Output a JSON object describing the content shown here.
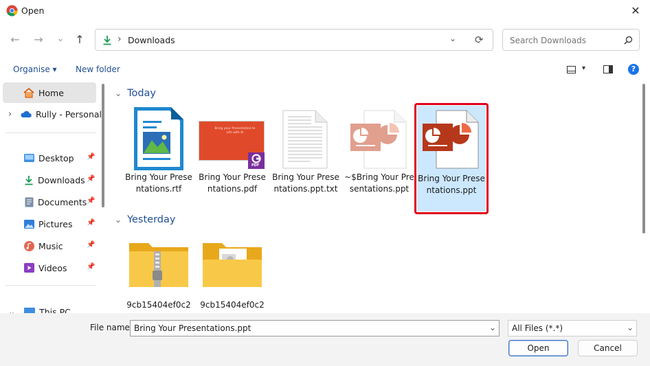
{
  "window": {
    "title": "Open",
    "close_glyph": "✕"
  },
  "nav": {
    "back": "←",
    "forward": "→",
    "recent": "⌄",
    "up": "↑"
  },
  "address": {
    "separator": "›",
    "location": "Downloads",
    "dropdown": "⌄",
    "refresh": "⟳"
  },
  "search": {
    "placeholder": "Search Downloads"
  },
  "commands": {
    "organise": "Organise",
    "new_folder": "New folder",
    "caret": "▾",
    "help": "?"
  },
  "sidebar": {
    "items": [
      {
        "label": "Home",
        "icon": "home-icon"
      },
      {
        "label": "Rully - Personal",
        "icon": "onedrive-icon"
      },
      {
        "label": "Desktop",
        "icon": "desktop-icon",
        "pinned": true
      },
      {
        "label": "Downloads",
        "icon": "downloads-icon",
        "pinned": true
      },
      {
        "label": "Documents",
        "icon": "documents-icon",
        "pinned": true
      },
      {
        "label": "Pictures",
        "icon": "pictures-icon",
        "pinned": true
      },
      {
        "label": "Music",
        "icon": "music-icon",
        "pinned": true
      },
      {
        "label": "Videos",
        "icon": "videos-icon",
        "pinned": true
      },
      {
        "label": "This PC",
        "icon": "pc-icon"
      }
    ],
    "chevron_right": "›",
    "chevron_down": "⌄",
    "pin_glyph": "📌"
  },
  "groups": {
    "today": "Today",
    "yesterday": "Yesterday",
    "collapse": "⌄"
  },
  "files": {
    "today": [
      {
        "name": "Bring Your Presentations.rtf"
      },
      {
        "name": "Bring Your Presentations.pdf"
      },
      {
        "name": "Bring Your Presentations.ppt.txt"
      },
      {
        "name": "~$Bring Your Presentations.ppt"
      },
      {
        "name": "Bring Your Presentations.ppt"
      }
    ],
    "yesterday": [
      {
        "name": "9cb15404ef0c2"
      },
      {
        "name": "9cb15404ef0c2"
      }
    ],
    "pdf_thumb_title": "Bring your Presentation to Life with AI",
    "pdf_badge": "PDF"
  },
  "footer": {
    "filename_label": "File name:",
    "filename_value": "Bring Your Presentations.ppt",
    "filter_value": "All Files (*.*)",
    "open_label": "Open",
    "cancel_label": "Cancel",
    "dropdown": "⌄"
  },
  "colors": {
    "accent": "#0067c0",
    "selection": "#cce8ff",
    "highlight": "#e0001b",
    "folder": "#f8c948"
  }
}
